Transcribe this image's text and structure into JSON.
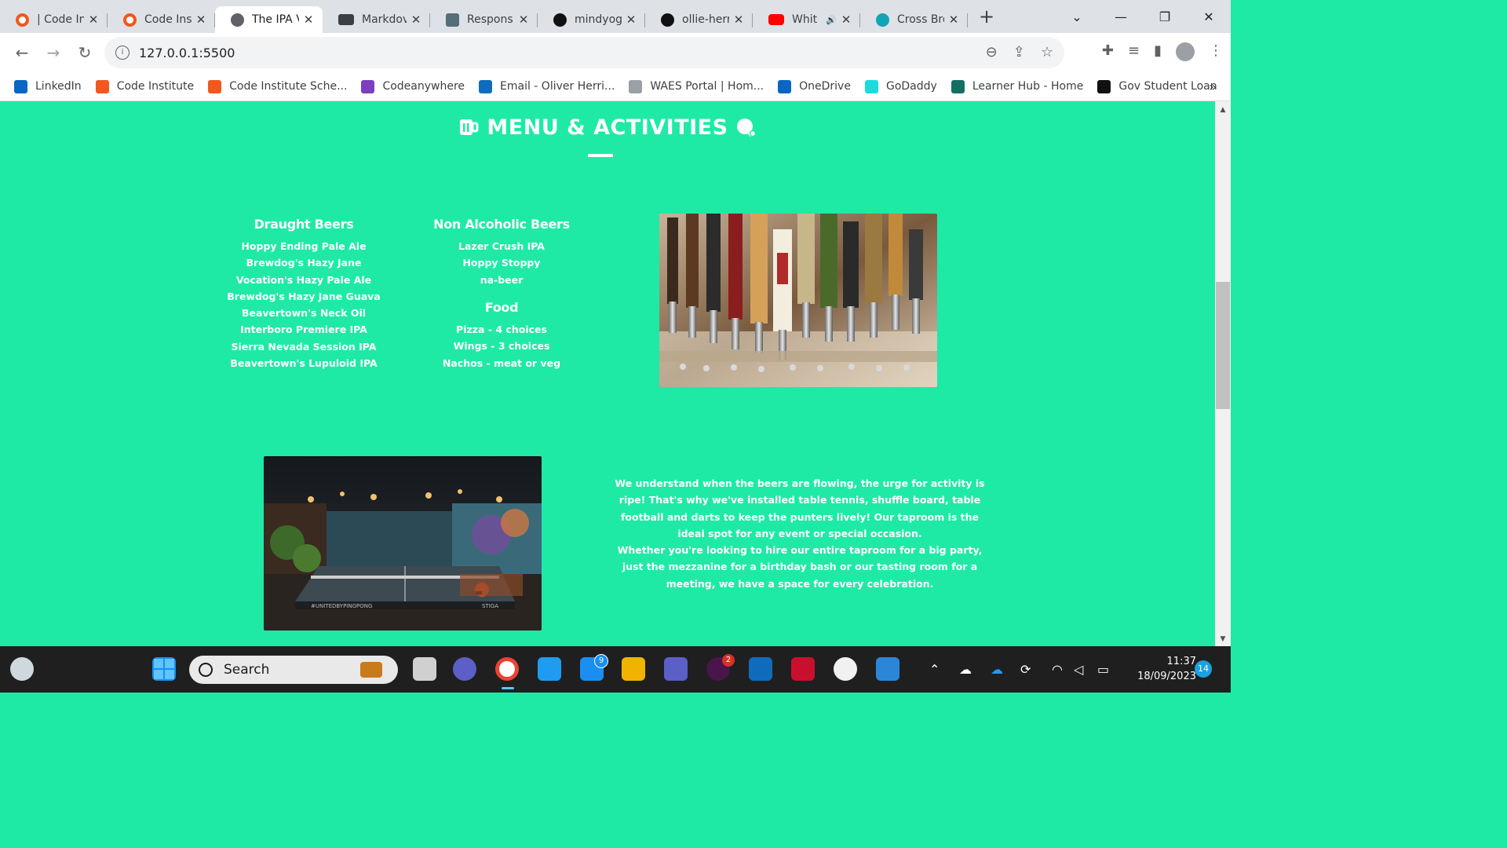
{
  "browser": {
    "tabs": [
      {
        "title": "| Code In",
        "icon": "code-institute-icon"
      },
      {
        "title": "Code Ins",
        "icon": "code-institute-icon"
      },
      {
        "title": "The IPA V",
        "icon": "globe-icon",
        "active": true
      },
      {
        "title": "Markdov",
        "icon": "markdown-icon"
      },
      {
        "title": "Respons",
        "icon": "r-icon"
      },
      {
        "title": "mindyog",
        "icon": "github-icon"
      },
      {
        "title": "ollie-herr",
        "icon": "github-icon"
      },
      {
        "title": "Whit",
        "icon": "youtube-icon",
        "audio": true
      },
      {
        "title": "Cross Bro",
        "icon": "cross-browser-icon"
      }
    ],
    "url": "127.0.0.1:5500",
    "bookmarks": [
      {
        "label": "LinkedIn",
        "color": "#0a66c2"
      },
      {
        "label": "Code Institute",
        "color": "#f3571d"
      },
      {
        "label": "Code Institute Sche...",
        "color": "#f3571d"
      },
      {
        "label": "Codeanywhere",
        "color": "#7b3fbf"
      },
      {
        "label": "Email - Oliver Herri...",
        "color": "#0f6cbd"
      },
      {
        "label": "WAES Portal | Hom...",
        "color": "#9aa0a6"
      },
      {
        "label": "OneDrive",
        "color": "#0a66c2"
      },
      {
        "label": "GoDaddy",
        "color": "#1bdbdb"
      },
      {
        "label": "Learner Hub - Home",
        "color": "#136f63"
      },
      {
        "label": "Gov Student Loan",
        "color": "#111111"
      }
    ]
  },
  "page": {
    "section_title": "MENU & ACTIVITIES",
    "draught": {
      "heading": "Draught Beers",
      "items": [
        "Hoppy Ending Pale Ale",
        "Brewdog's Hazy Jane",
        "Vocation's Hazy Pale Ale",
        "Brewdog's Hazy Jane Guava",
        "Beavertown's Neck Oil",
        "Interboro Premiere IPA",
        "Sierra Nevada Session IPA",
        "Beavertown's Lupuloid IPA"
      ]
    },
    "non_alcoholic": {
      "heading": "Non Alcoholic Beers",
      "items": [
        "Lazer Crush IPA",
        "Hoppy Stoppy",
        "na-beer"
      ]
    },
    "food": {
      "heading": "Food",
      "items": [
        "Pizza - 4 choices",
        "Wings - 3 choices",
        "Nachos - meat or veg"
      ]
    },
    "activities_text": [
      "We understand when the beers are flowing, the urge for activity is ripe! That's why we've installed table tennis, shuffle board, table football and darts to keep the punters lively! Our taproom is the ideal spot for any event or special occasion.",
      "Whether you're looking to hire our entire taproom for a big party, just the mezzanine for a birthday bash or our tasting room for a meeting, we have a space for every celebration."
    ],
    "room_image_caption": "#UNITEDBYPINGPONG",
    "room_image_brand": "STIGA",
    "accent_color": "#1eeaa6"
  },
  "taskbar": {
    "search_label": "Search",
    "time": "11:37",
    "date": "18/09/2023",
    "notification_count": "14",
    "mail_badge": "9",
    "slack_badge": "2"
  }
}
